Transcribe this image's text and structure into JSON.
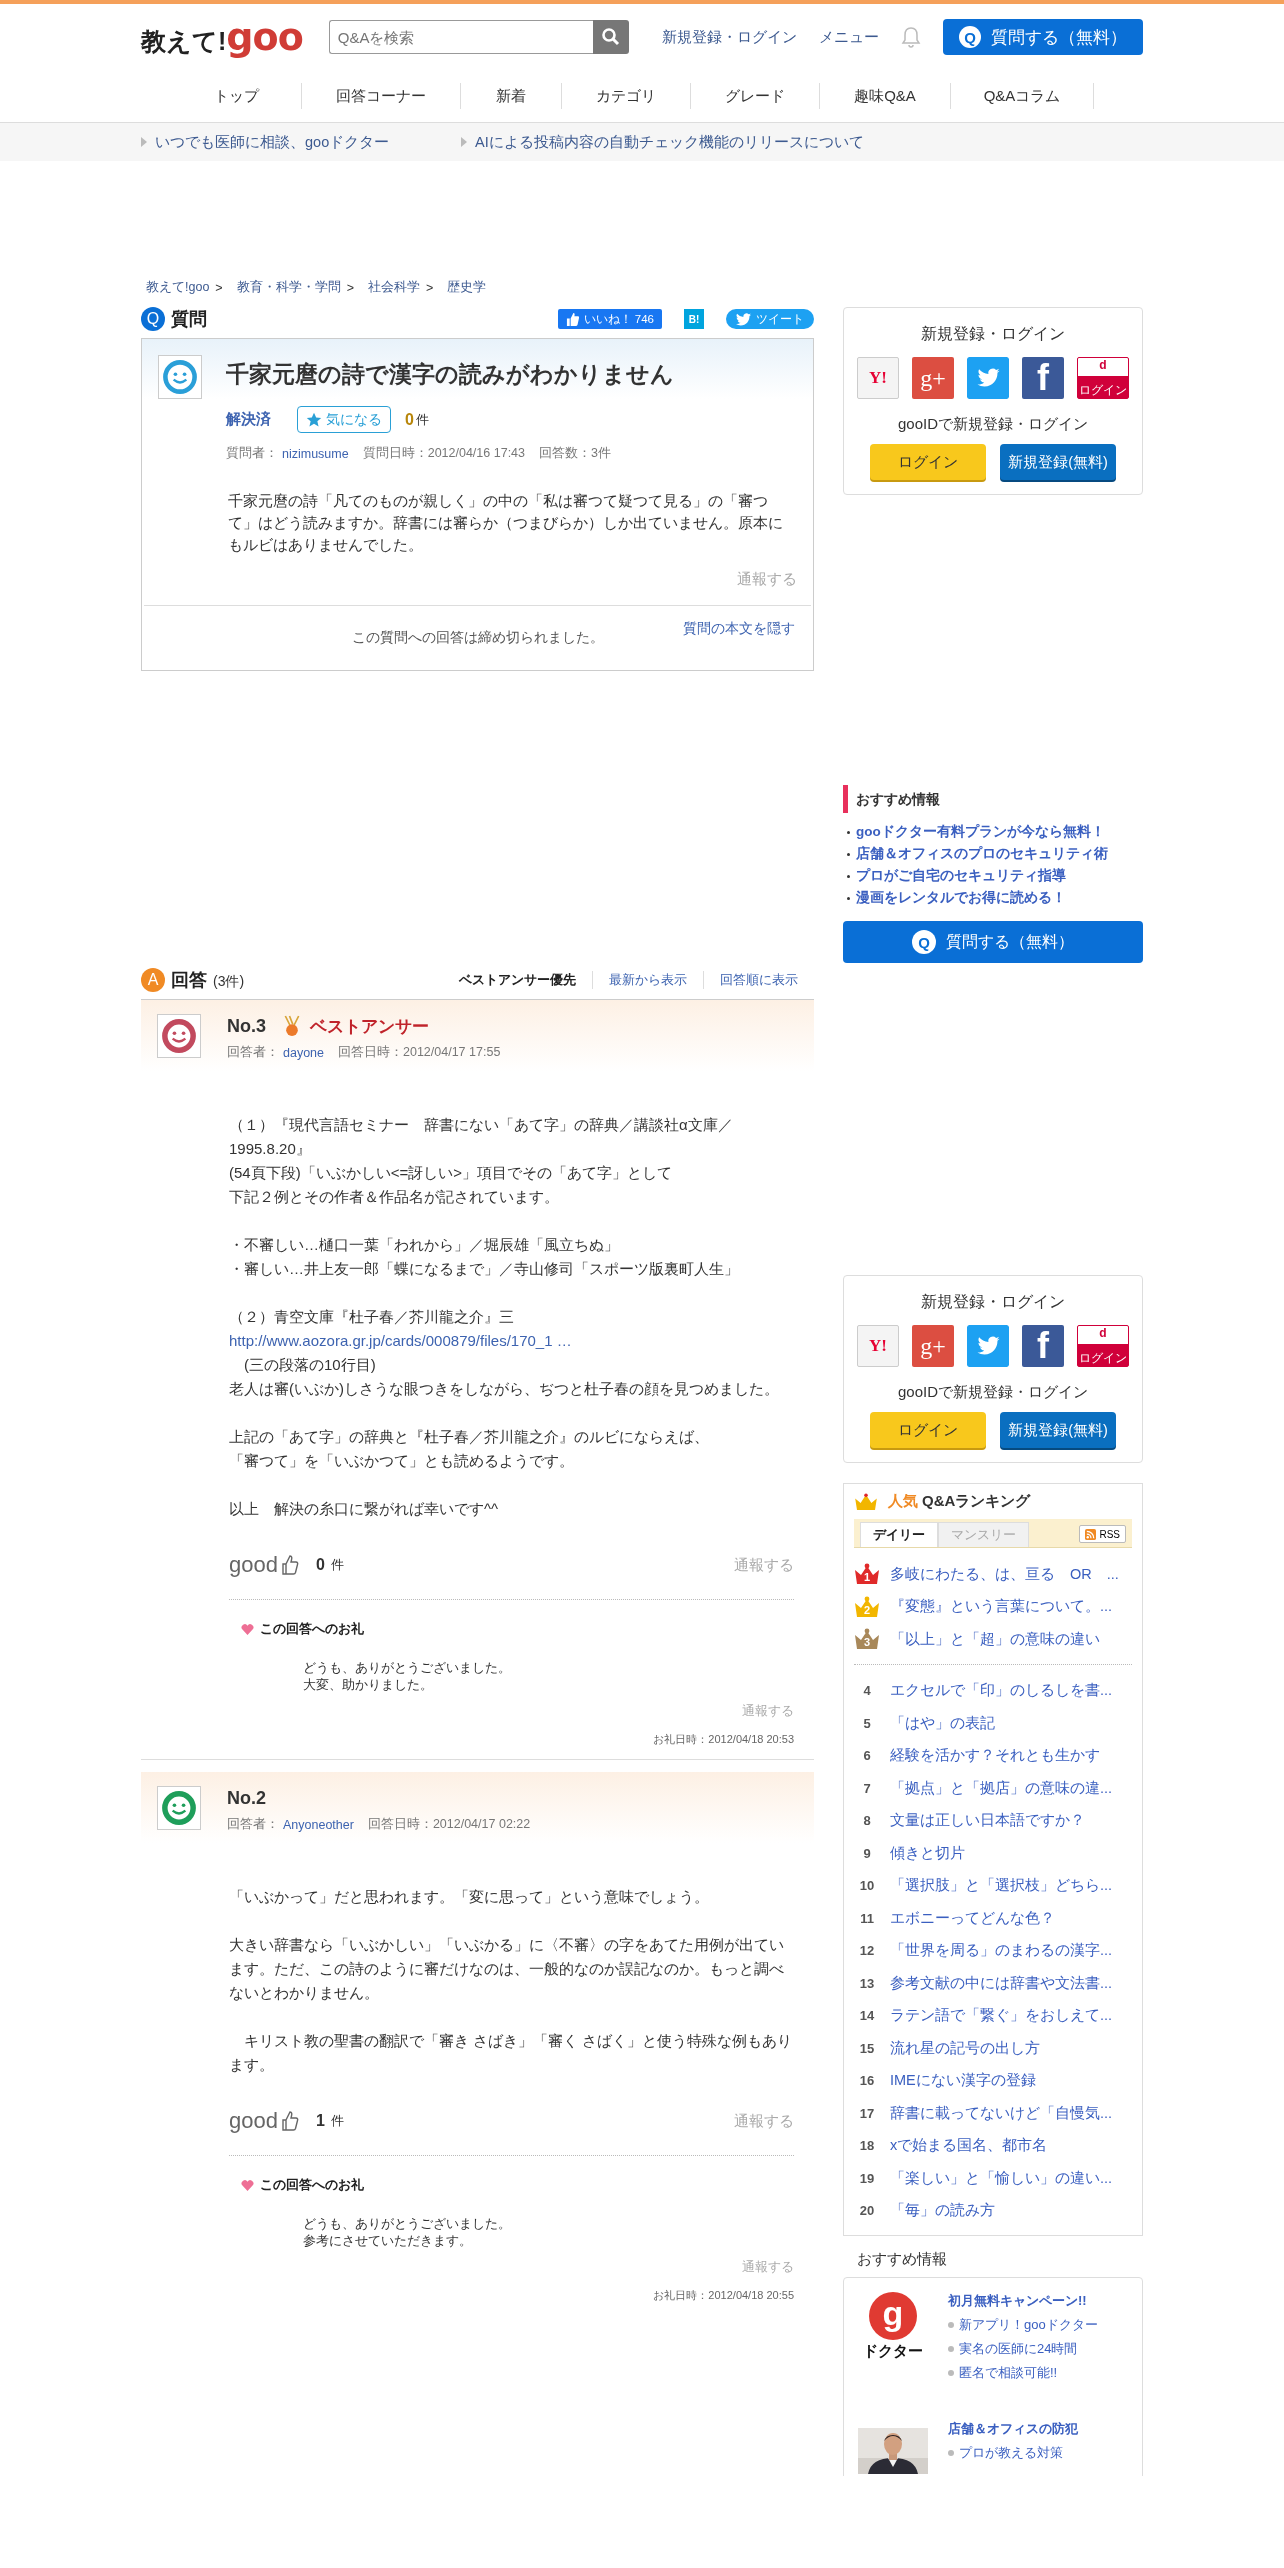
{
  "header": {
    "logo": {
      "prefix": "教えて!",
      "brand": "goo"
    },
    "search": {
      "placeholder": "Q&Aを検索"
    },
    "links": [
      "新規登録・ログイン",
      "メニュー"
    ],
    "ask_button": {
      "icon": "Q",
      "label": "質問する（無料）"
    }
  },
  "nav": [
    "トップ",
    "回答コーナー",
    "新着",
    "カテゴリ",
    "グレード",
    "趣味Q&A",
    "Q&Aコラム"
  ],
  "notices": [
    "いつでも医師に相談、gooドクター",
    "AIによる投稿内容の自動チェック機能のリリースについて"
  ],
  "breadcrumb": {
    "separator": ">",
    "items": [
      "教えて!goo",
      "教育・科学・学問",
      "社会科学",
      "歴史学"
    ]
  },
  "question": {
    "badge": "Q",
    "heading": "質問",
    "share": {
      "like_label": "いいね！",
      "like_count": "746",
      "hatena": "B!",
      "tweet": "ツイート"
    },
    "title": "千家元麿の詩で漢字の読みがわかりません",
    "status": "解決済",
    "watch": {
      "label": "気になる",
      "count": "0",
      "unit": "件"
    },
    "meta": {
      "asker_label": "質問者：",
      "asker": "nizimusume",
      "date": "質問日時：2012/04/16 17:43",
      "answers": "回答数：3件"
    },
    "body": "千家元麿の詩「凡てのものが親しく」の中の「私は審つて疑つて見る」の「審つて」はどう読みますか。辞書には審らか（つまびらか）しか出ていません。原本にもルビはありませんでした。",
    "report": "通報する",
    "closed_notice": "この質問への回答は締め切られました。",
    "hide_link": "質問の本文を隠す"
  },
  "answers": {
    "badge": "A",
    "heading": "回答",
    "count": "(3件)",
    "sort": [
      {
        "label": "ベストアンサー優先",
        "selected": true
      },
      {
        "label": "最新から表示",
        "selected": false
      },
      {
        "label": "回答順に表示",
        "selected": false
      }
    ],
    "items": [
      {
        "number": "No.3",
        "best": true,
        "best_label": "ベストアンサー",
        "color": "#c24a5e",
        "answerer_label": "回答者：",
        "answerer": "dayone",
        "date": "回答日時：2012/04/17 17:55",
        "paragraphs": [
          [
            {
              "kind": "text",
              "text": "（１）『現代言語セミナー　辞書にない「あて字」の辞典／講談社α文庫／1995.8.20』"
            },
            {
              "kind": "text",
              "text": "(54頁下段)「いぶかしい<=訝しい>」項目でその「あて字」として"
            },
            {
              "kind": "text",
              "text": "下記２例とその作者＆作品名が記されています。"
            }
          ],
          [
            {
              "kind": "text",
              "text": "・不審しい…樋口一葉「われから」／堀辰雄「風立ちぬ」"
            },
            {
              "kind": "text",
              "text": "・審しい…井上友一郎「蝶になるまで」／寺山修司「スポーツ版裏町人生」"
            }
          ],
          [
            {
              "kind": "text",
              "text": "（２）青空文庫『杜子春／芥川龍之介』三"
            },
            {
              "kind": "link",
              "text": "http://www.aozora.gr.jp/cards/000879/files/170_1 …"
            },
            {
              "kind": "text",
              "text": "　(三の段落の10行目)"
            },
            {
              "kind": "text",
              "text": "老人は審(いぶか)しさうな眼つきをしながら、ぢつと杜子春の顔を見つめました。"
            }
          ],
          [
            {
              "kind": "text",
              "text": "上記の「あて字」の辞典と『杜子春／芥川龍之介』のルビにならえば、"
            },
            {
              "kind": "text",
              "text": "「審つて」を「いぶかつて」とも読めるようです。"
            }
          ],
          [
            {
              "kind": "text",
              "text": "以上　解決の糸口に繋がれば幸いです^^"
            }
          ]
        ],
        "good": {
          "label": "good",
          "count": "0",
          "unit": "件"
        },
        "report": "通報する",
        "thanks": {
          "heading": "この回答へのお礼",
          "lines": [
            "どうも、ありがとうございました。",
            "大変、助かりました。"
          ],
          "report": "通報する",
          "date": "お礼日時：2012/04/18 20:53"
        }
      },
      {
        "number": "No.2",
        "best": false,
        "color": "#1e9e5a",
        "answerer_label": "回答者：",
        "answerer": "Anyoneother",
        "date": "回答日時：2012/04/17 02:22",
        "paragraphs": [
          [
            {
              "kind": "text",
              "text": "「いぶかって」だと思われます。「変に思って」という意味でしょう。"
            }
          ],
          [
            {
              "kind": "text",
              "text": "大きい辞書なら「いぶかしい」「いぶかる」に〈不審〉の字をあてた用例が出ています。ただ、この詩のように審だけなのは、一般的なのか誤記なのか。もっと調べないとわかりません。"
            }
          ],
          [
            {
              "kind": "text",
              "text": "　キリスト教の聖書の翻訳で「審き さばき」「審く さばく」と使う特殊な例もあります。"
            }
          ]
        ],
        "good": {
          "label": "good",
          "count": "1",
          "unit": "件"
        },
        "report": "通報する",
        "thanks": {
          "heading": "この回答へのお礼",
          "lines": [
            "どうも、ありがとうございました。",
            "参考にさせていただきます。"
          ],
          "report": "通報する",
          "date": "お礼日時：2012/04/18 20:55"
        }
      }
    ]
  },
  "sidebar": {
    "login_top": {
      "title": "新規登録・ログイン",
      "social": [
        {
          "kind": "yahoo",
          "text": "Y!"
        },
        {
          "kind": "google",
          "text": "g+"
        },
        {
          "kind": "twitter"
        },
        {
          "kind": "facebook",
          "text": "f"
        },
        {
          "kind": "docomo",
          "text": "d",
          "caption": "ログイン"
        }
      ],
      "subtitle": "gooIDで新規登録・ログイン",
      "login": "ログイン",
      "register": "新規登録(無料)"
    },
    "promo": {
      "title": "おすすめ情報",
      "links": [
        "gooドクター有料プランが今なら無料！",
        "店舗＆オフィスのプロのセキュリティ術",
        "プロがご自宅のセキュリティ指導",
        "漫画をレンタルでお得に読める！"
      ]
    },
    "ask_button": {
      "icon": "Q",
      "label": "質問する（無料）"
    },
    "login_bottom": {
      "title": "新規登録・ログイン",
      "social": [
        {
          "kind": "yahoo",
          "text": "Y!"
        },
        {
          "kind": "google",
          "text": "g+"
        },
        {
          "kind": "twitter"
        },
        {
          "kind": "facebook",
          "text": "f"
        },
        {
          "kind": "docomo",
          "text": "d",
          "caption": "ログイン"
        }
      ],
      "subtitle": "gooIDで新規登録・ログイン",
      "login": "ログイン",
      "register": "新規登録(無料)"
    },
    "ranking": {
      "title_accent": "人気",
      "title": "Q&Aランキング",
      "tabs": [
        {
          "label": "デイリー",
          "selected": true
        },
        {
          "label": "マンスリー",
          "selected": false
        }
      ],
      "rss": "RSS",
      "items": [
        {
          "rank": "1",
          "title": "多岐にわたる、は、亘る　OR　..."
        },
        {
          "rank": "2",
          "title": "『変態』という言葉について。..."
        },
        {
          "rank": "3",
          "title": "「以上」と「超」の意味の違い"
        },
        {
          "rank": "4",
          "title": "エクセルで「印」のしるしを書..."
        },
        {
          "rank": "5",
          "title": "「はや」の表記"
        },
        {
          "rank": "6",
          "title": "経験を活かす？それとも生かす"
        },
        {
          "rank": "7",
          "title": "「拠点」と「拠店」の意味の違..."
        },
        {
          "rank": "8",
          "title": "文量は正しい日本語ですか？"
        },
        {
          "rank": "9",
          "title": "傾きと切片"
        },
        {
          "rank": "10",
          "title": "「選択肢」と「選択枝」どちら..."
        },
        {
          "rank": "11",
          "title": "エボニーってどんな色？"
        },
        {
          "rank": "12",
          "title": "「世界を周る」のまわるの漢字..."
        },
        {
          "rank": "13",
          "title": "参考文献の中には辞書や文法書..."
        },
        {
          "rank": "14",
          "title": "ラテン語で「繋ぐ」をおしえて..."
        },
        {
          "rank": "15",
          "title": "流れ星の記号の出し方"
        },
        {
          "rank": "16",
          "title": "IMEにない漢字の登録"
        },
        {
          "rank": "17",
          "title": "辞書に載ってないけど「自慢気..."
        },
        {
          "rank": "18",
          "title": "xで始まる国名、都市名"
        },
        {
          "rank": "19",
          "title": "「楽しい」と「愉しい」の違い..."
        },
        {
          "rank": "20",
          "title": "「毎」の読み方"
        }
      ]
    },
    "featured": {
      "heading": "おすすめ情報",
      "items": [
        {
          "kind": "logo",
          "logo_letter": "g",
          "logo_caption": "ドクター",
          "title": "初月無料キャンペーン!!",
          "points": [
            "新アプリ！gooドクター",
            "実名の医師に24時間",
            "匿名で相談可能!!"
          ]
        },
        {
          "kind": "picture",
          "title": "店舗＆オフィスの防犯",
          "points": [
            "プロが教える対策"
          ]
        }
      ]
    }
  }
}
